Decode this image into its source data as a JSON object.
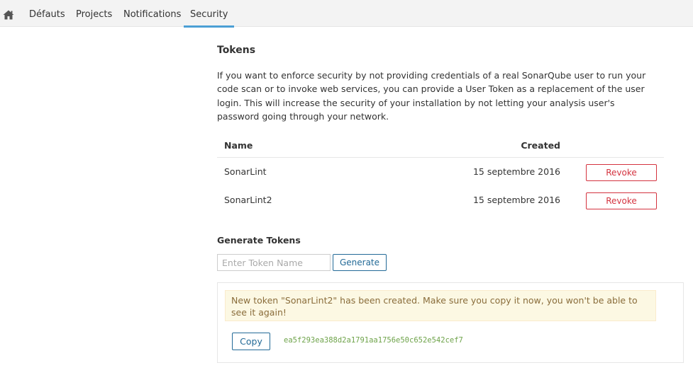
{
  "nav": {
    "home_icon": "home-icon",
    "tabs": [
      {
        "label": "Défauts"
      },
      {
        "label": "Projects"
      },
      {
        "label": "Notifications"
      },
      {
        "label": "Security",
        "active": true
      }
    ],
    "active_color": "#4b9fd5"
  },
  "tokens": {
    "title": "Tokens",
    "description": "If you want to enforce security by not providing credentials of a real SonarQube user to run your code scan or to invoke web services, you can provide a User Token as a replacement of the user login. This will increase the security of your installation by not letting your analysis user's password going through your network.",
    "columns": {
      "name": "Name",
      "created": "Created"
    },
    "rows": [
      {
        "name": "SonarLint",
        "created": "15 septembre 2016",
        "action": "Revoke"
      },
      {
        "name": "SonarLint2",
        "created": "15 septembre 2016",
        "action": "Revoke"
      }
    ],
    "revoke_color": "#d4333f"
  },
  "generate": {
    "title": "Generate Tokens",
    "placeholder": "Enter Token Name",
    "value": "",
    "button_label": "Generate"
  },
  "new_token": {
    "message": "New token \"SonarLint2\" has been created. Make sure you copy it now, you won't be able to see it again!",
    "copy_label": "Copy",
    "token": "ea5f293ea388d2a1791aa1756e50c652e542cef7",
    "token_color": "#6ea34a"
  }
}
